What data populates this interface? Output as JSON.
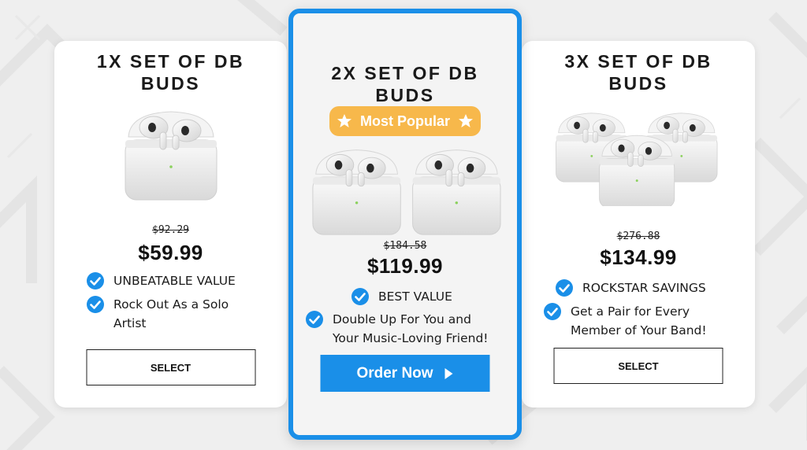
{
  "theme": {
    "accent": "#1a8fe8",
    "badge_bg": "#f7b84b",
    "check_color": "#1a8fe8",
    "background": "#efefef"
  },
  "cards": [
    {
      "title_line1": "1X SET OF DB",
      "title_line2": "BUDS",
      "product_image": "earbuds-case-x1",
      "old_price": "$92.29",
      "price": "$59.99",
      "features": [
        {
          "line1": "UNBEATABLE VALUE",
          "line2": ""
        },
        {
          "line1": "Rock Out As a Solo",
          "line2": "Artist"
        }
      ],
      "button_label": "SELECT",
      "highlighted": false
    },
    {
      "title_line1": "2X SET OF DB",
      "title_line2": "BUDS",
      "badge_label": "Most Popular",
      "product_image": "earbuds-case-x2",
      "old_price": "$184.58",
      "price": "$119.99",
      "features": [
        {
          "line1": "BEST VALUE",
          "line2": ""
        },
        {
          "line1": "Double Up For You and",
          "line2": "Your Music-Loving Friend!"
        }
      ],
      "button_label": "Order Now",
      "button_icon": "play-arrow-icon",
      "highlighted": true
    },
    {
      "title_line1": "3X SET OF DB",
      "title_line2": "BUDS",
      "product_image": "earbuds-case-x3",
      "old_price": "$276.88",
      "price": "$134.99",
      "features": [
        {
          "line1": "ROCKSTAR SAVINGS",
          "line2": ""
        },
        {
          "line1": "Get a Pair for Every",
          "line2": "Member of Your Band!"
        }
      ],
      "button_label": "SELECT",
      "highlighted": false
    }
  ]
}
